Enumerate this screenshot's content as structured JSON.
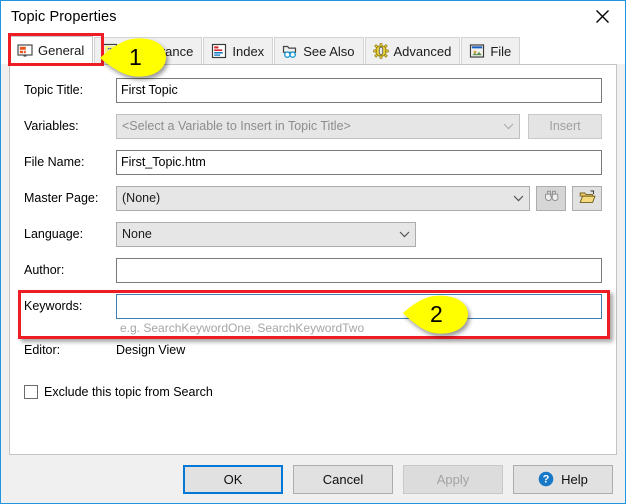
{
  "window": {
    "title": "Topic Properties",
    "close_label": "×",
    "close_icon": "close-icon"
  },
  "tabs": [
    {
      "label": "General",
      "icon": "monitor-icon",
      "selected": true
    },
    {
      "label": "Appearance",
      "icon": "question-box-icon",
      "selected": false
    },
    {
      "label": "Index",
      "icon": "index-list-icon",
      "selected": false
    },
    {
      "label": "See Also",
      "icon": "binoculars-folder-icon",
      "selected": false
    },
    {
      "label": "Advanced",
      "icon": "gear-icon",
      "selected": false
    },
    {
      "label": "File",
      "icon": "file-window-icon",
      "selected": false
    }
  ],
  "form": {
    "topic_title": {
      "label": "Topic Title:",
      "value": "First Topic",
      "placeholder": ""
    },
    "variables": {
      "label": "Variables:",
      "value": "<Select a Variable to Insert in Topic Title>",
      "insert_label": "Insert",
      "disabled": true
    },
    "file_name": {
      "label": "File Name:",
      "value": "First_Topic.htm",
      "placeholder": ""
    },
    "master_page": {
      "label": "Master Page:",
      "value": "(None)",
      "browse_icon": "binoculars-icon",
      "open_icon": "open-folder-icon"
    },
    "language": {
      "label": "Language:",
      "value": "None"
    },
    "author": {
      "label": "Author:",
      "value": "",
      "placeholder": ""
    },
    "keywords": {
      "label": "Keywords:",
      "value": "",
      "placeholder": "",
      "hint": "e.g. SearchKeywordOne, SearchKeywordTwo"
    },
    "editor": {
      "label": "Editor:",
      "value": "Design View"
    },
    "exclude_from_search": {
      "label": "Exclude this topic from Search",
      "checked": false
    }
  },
  "buttons": {
    "ok": "OK",
    "cancel": "Cancel",
    "apply": "Apply",
    "help": "Help",
    "help_icon": "help-circle-icon"
  },
  "annotations": {
    "callout_1": "1",
    "callout_2": "2",
    "highlight_color": "#ee1c25",
    "callout_color": "#ffff00"
  }
}
